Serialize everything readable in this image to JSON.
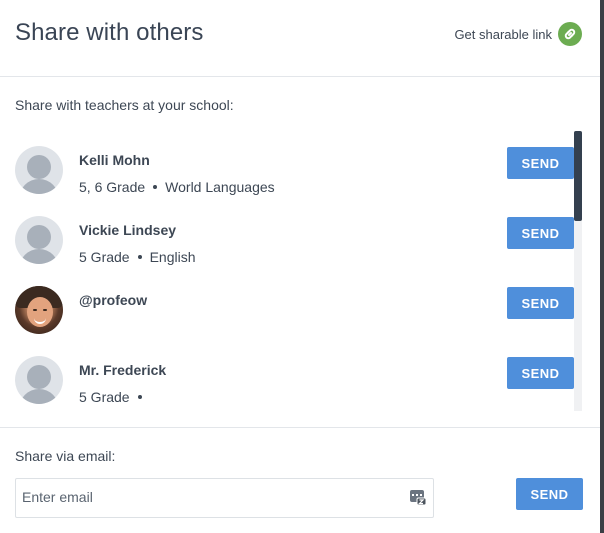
{
  "header": {
    "title": "Share with others",
    "share_link_label": "Get sharable link"
  },
  "teachers_section": {
    "label": "Share with teachers at your school:",
    "items": [
      {
        "name": "Kelli Mohn",
        "grade": "5, 6 Grade",
        "subject": "World Languages",
        "avatar": "default-avatar",
        "button": "SEND"
      },
      {
        "name": "Vickie Lindsey",
        "grade": "5 Grade",
        "subject": "English",
        "avatar": "default-avatar",
        "button": "SEND"
      },
      {
        "name": "@profeow",
        "grade": "",
        "subject": "",
        "avatar": "photo-avatar",
        "button": "SEND"
      },
      {
        "name": "Mr. Frederick",
        "grade": "5 Grade",
        "subject": "",
        "avatar": "default-avatar",
        "button": "SEND"
      }
    ]
  },
  "email_section": {
    "label": "Share via email:",
    "placeholder": "Enter email",
    "value": "",
    "button": "SEND"
  },
  "colors": {
    "accent": "#4f8fdb",
    "link_icon": "#6cac51",
    "text": "#3d4754",
    "scrollbar": "#34404f"
  },
  "icons": {
    "share_link": "link-icon",
    "contacts": "contacts-icon"
  }
}
